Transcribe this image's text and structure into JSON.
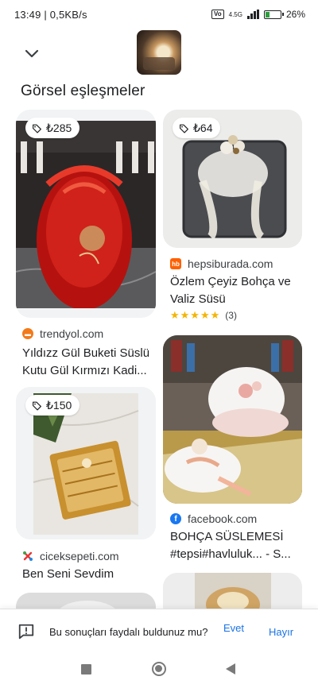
{
  "status_bar": {
    "time_speed": "13:49 | 0,5KB/s",
    "network": "4.5G",
    "battery": "26",
    "battery_pct": 0.26
  },
  "header": {
    "heading": "Görsel eşleşmeler"
  },
  "results": [
    {
      "price": "₺285",
      "source": "trendyol.com",
      "title_line1": "Yıldızz Gül Buketi Süslü",
      "title_line2": "Kutu Gül Kırmızı Kadi...",
      "favicon_color": "#f27a1a"
    },
    {
      "price": "₺64",
      "source": "hepsiburada.com",
      "title_line1": "Özlem Çeyiz Bohça ve",
      "title_line2": "Valiz Süsü",
      "rating": "★★★★★",
      "rating_count": "(3)",
      "favicon_text": "hb",
      "favicon_color": "#ff6000"
    },
    {
      "price": "₺150",
      "source": "ciceksepeti.com",
      "title_line1": "Ben Seni Sevdim"
    },
    {
      "source": "facebook.com",
      "title_line1": "BOHÇA SÜSLEMESİ",
      "title_line2": "#tepsi#havluluk... - S...",
      "favicon_color": "#1877f2"
    }
  ],
  "feedback": {
    "question": "Bu sonuçları faydalı buldunuz mu?",
    "yes": "Evet",
    "no": "Hayır"
  },
  "icons": {
    "collapse": "chevron-down-icon",
    "price_tag": "tag-icon",
    "feedback": "feedback-icon"
  }
}
